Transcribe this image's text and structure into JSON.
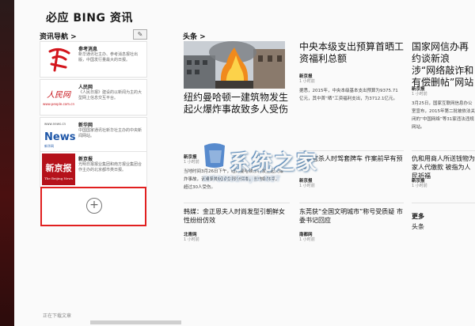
{
  "app": {
    "title": "必应 BING 资讯"
  },
  "nav": {
    "header": "资讯导航 >",
    "edit_icon": "pencil-icon",
    "cards": [
      {
        "logo_text": "参",
        "name": "参考消息",
        "desc": "新华通讯社主办、参考消息报社出版，中国发行量最大的日报。"
      },
      {
        "logo_text": "人民网",
        "logo_sub": "www.people.com.cn",
        "name": "人民网",
        "desc": "《人民日报》建设的以新闻为主的大型网上信息交互平台。"
      },
      {
        "logo_text": "News",
        "logo_top": "www.news.cn",
        "logo_sub": "新华网",
        "name": "新华网",
        "desc": "中国国家通讯社新华社主办的中央新闻网站。"
      },
      {
        "logo_text": "新京报",
        "logo_sub": "The Beijing News",
        "name": "新京报",
        "desc": "光明日报报业集团和南方报业集团合作主办的北京都市类日报。"
      }
    ],
    "add_icon": "plus-circle-icon",
    "status": "正在下载文章"
  },
  "headlines": {
    "header": "头条 >",
    "hero": {
      "title": "纽约曼哈顿一建筑物发生起火爆炸事故致多人受伤",
      "source": "新京报",
      "time": "1 小时前",
      "snippet": "当地时间3月26日下午，纽约曼哈顿东村发生起火爆炸事故，该建筑物因发生部分倒塌，当地媒体称，超过30人受伤。"
    },
    "bottom_left": {
      "title": "韩媒：金正恩夫人时尚发型引朝鲜女性纷纷仿效",
      "source": "北青网",
      "time": "1 小时前"
    },
    "col2_top": {
      "title": "中央本级支出预算首晒工资福利总额",
      "source": "新京报",
      "time": "1 小时前",
      "snippet": "据悉，2015年，中央本级基本支出预算为9375.71亿元，其中首“晒”工资福利支出，为3712.1亿元。"
    },
    "col2_mid": {
      "title": "京高官杀人时驾套牌车 作案前早有预谋",
      "source": "新京报",
      "time": "1 小时前"
    },
    "col2_bottom": {
      "title": "东莞获“全国文明城市”称号受质疑 市委书记回应",
      "source": "南都网",
      "time": "1 小时前"
    },
    "col3_top": {
      "title": "国家网信办再约谈新浪 涉“网络敲诈和有偿删帖”网站",
      "source": "新京报",
      "time": "1 小时前",
      "snippet": "3月25日，国家互联网信息办公室宣布，2015年第二批被依法关闭的“中国网络”等31家违法违规网站。"
    },
    "col3_mid": {
      "title": "仇和用商人所送钱物为家人代缴款 被指为人民祈福",
      "source": "新京报",
      "time": "1 小时前"
    },
    "more": {
      "title": "更多",
      "item": "头条"
    }
  },
  "watermark": {
    "main": "系统之家",
    "url": "XITONGZHIJIA.NET",
    "logo_icon": "windows-logo-icon"
  },
  "colors": {
    "highlight": "#e12020",
    "people_red": "#c8161d",
    "xinhua_blue": "#1f57a8"
  }
}
